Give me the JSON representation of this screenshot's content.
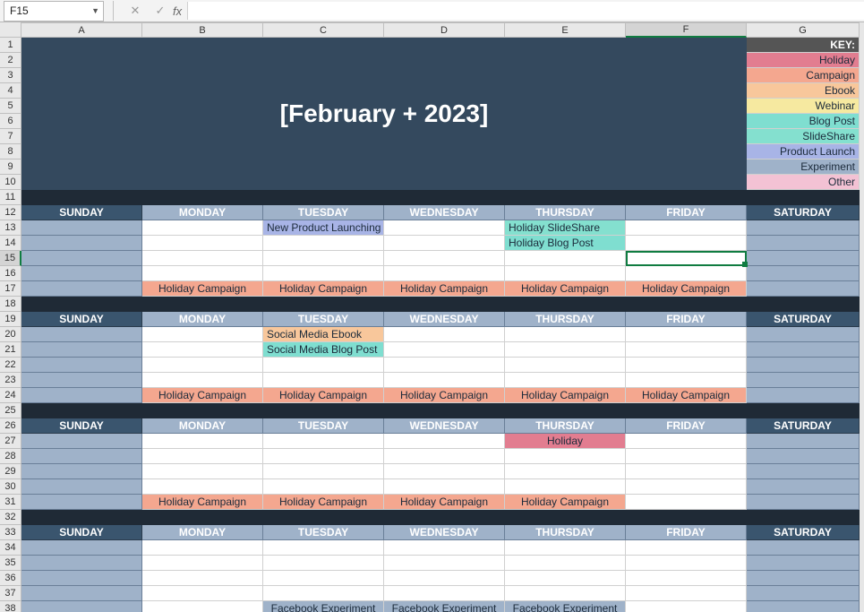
{
  "formula_bar": {
    "name_box": "F15",
    "fx_label": "fx"
  },
  "columns": [
    "A",
    "B",
    "C",
    "D",
    "E",
    "F",
    "G"
  ],
  "rows": [
    "1",
    "2",
    "3",
    "4",
    "5",
    "6",
    "7",
    "8",
    "9",
    "10",
    "11",
    "12",
    "13",
    "14",
    "15",
    "16",
    "17",
    "18",
    "19",
    "20",
    "21",
    "22",
    "23",
    "24",
    "25",
    "26",
    "27",
    "28",
    "29",
    "30",
    "31",
    "32",
    "33",
    "34",
    "35",
    "36",
    "37",
    "38"
  ],
  "title": "[February + 2023]",
  "key_header": "KEY:",
  "key": [
    {
      "label": "Holiday",
      "cls": "c-holiday"
    },
    {
      "label": "Campaign",
      "cls": "c-campaign"
    },
    {
      "label": "Ebook",
      "cls": "c-ebook"
    },
    {
      "label": "Webinar",
      "cls": "c-webinar"
    },
    {
      "label": "Blog Post",
      "cls": "c-blog"
    },
    {
      "label": "SlideShare",
      "cls": "c-slideshare"
    },
    {
      "label": "Product Launch",
      "cls": "c-launch"
    },
    {
      "label": "Experiment",
      "cls": "c-experiment"
    },
    {
      "label": "Other",
      "cls": "c-other"
    }
  ],
  "days": [
    "SUNDAY",
    "MONDAY",
    "TUESDAY",
    "WEDNESDAY",
    "THURSDAY",
    "FRIDAY",
    "SATURDAY"
  ],
  "week1": {
    "tue_r13": "New Product Launching",
    "thu_r13": "Holiday SlideShare",
    "thu_r14": "Holiday Blog Post",
    "campaign": "Holiday Campaign"
  },
  "week2": {
    "tue_r20": "Social Media Ebook",
    "tue_r21": "Social Media Blog Post",
    "campaign": "Holiday Campaign"
  },
  "week3": {
    "thu_r27": "Holiday",
    "campaign": "Holiday Campaign"
  },
  "week4": {
    "experiment": "Facebook Experiment"
  },
  "selected_cell": "F15"
}
